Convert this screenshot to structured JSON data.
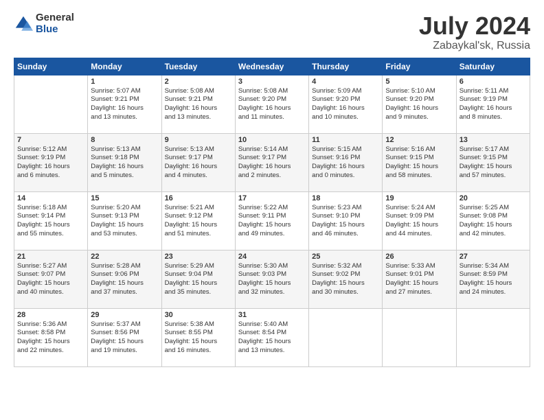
{
  "logo": {
    "general": "General",
    "blue": "Blue"
  },
  "title": "July 2024",
  "subtitle": "Zabaykal'sk, Russia",
  "days_header": [
    "Sunday",
    "Monday",
    "Tuesday",
    "Wednesday",
    "Thursday",
    "Friday",
    "Saturday"
  ],
  "weeks": [
    [
      {
        "num": "",
        "info": ""
      },
      {
        "num": "1",
        "info": "Sunrise: 5:07 AM\nSunset: 9:21 PM\nDaylight: 16 hours\nand 13 minutes."
      },
      {
        "num": "2",
        "info": "Sunrise: 5:08 AM\nSunset: 9:21 PM\nDaylight: 16 hours\nand 13 minutes."
      },
      {
        "num": "3",
        "info": "Sunrise: 5:08 AM\nSunset: 9:20 PM\nDaylight: 16 hours\nand 11 minutes."
      },
      {
        "num": "4",
        "info": "Sunrise: 5:09 AM\nSunset: 9:20 PM\nDaylight: 16 hours\nand 10 minutes."
      },
      {
        "num": "5",
        "info": "Sunrise: 5:10 AM\nSunset: 9:20 PM\nDaylight: 16 hours\nand 9 minutes."
      },
      {
        "num": "6",
        "info": "Sunrise: 5:11 AM\nSunset: 9:19 PM\nDaylight: 16 hours\nand 8 minutes."
      }
    ],
    [
      {
        "num": "7",
        "info": "Sunrise: 5:12 AM\nSunset: 9:19 PM\nDaylight: 16 hours\nand 6 minutes."
      },
      {
        "num": "8",
        "info": "Sunrise: 5:13 AM\nSunset: 9:18 PM\nDaylight: 16 hours\nand 5 minutes."
      },
      {
        "num": "9",
        "info": "Sunrise: 5:13 AM\nSunset: 9:17 PM\nDaylight: 16 hours\nand 4 minutes."
      },
      {
        "num": "10",
        "info": "Sunrise: 5:14 AM\nSunset: 9:17 PM\nDaylight: 16 hours\nand 2 minutes."
      },
      {
        "num": "11",
        "info": "Sunrise: 5:15 AM\nSunset: 9:16 PM\nDaylight: 16 hours\nand 0 minutes."
      },
      {
        "num": "12",
        "info": "Sunrise: 5:16 AM\nSunset: 9:15 PM\nDaylight: 15 hours\nand 58 minutes."
      },
      {
        "num": "13",
        "info": "Sunrise: 5:17 AM\nSunset: 9:15 PM\nDaylight: 15 hours\nand 57 minutes."
      }
    ],
    [
      {
        "num": "14",
        "info": "Sunrise: 5:18 AM\nSunset: 9:14 PM\nDaylight: 15 hours\nand 55 minutes."
      },
      {
        "num": "15",
        "info": "Sunrise: 5:20 AM\nSunset: 9:13 PM\nDaylight: 15 hours\nand 53 minutes."
      },
      {
        "num": "16",
        "info": "Sunrise: 5:21 AM\nSunset: 9:12 PM\nDaylight: 15 hours\nand 51 minutes."
      },
      {
        "num": "17",
        "info": "Sunrise: 5:22 AM\nSunset: 9:11 PM\nDaylight: 15 hours\nand 49 minutes."
      },
      {
        "num": "18",
        "info": "Sunrise: 5:23 AM\nSunset: 9:10 PM\nDaylight: 15 hours\nand 46 minutes."
      },
      {
        "num": "19",
        "info": "Sunrise: 5:24 AM\nSunset: 9:09 PM\nDaylight: 15 hours\nand 44 minutes."
      },
      {
        "num": "20",
        "info": "Sunrise: 5:25 AM\nSunset: 9:08 PM\nDaylight: 15 hours\nand 42 minutes."
      }
    ],
    [
      {
        "num": "21",
        "info": "Sunrise: 5:27 AM\nSunset: 9:07 PM\nDaylight: 15 hours\nand 40 minutes."
      },
      {
        "num": "22",
        "info": "Sunrise: 5:28 AM\nSunset: 9:06 PM\nDaylight: 15 hours\nand 37 minutes."
      },
      {
        "num": "23",
        "info": "Sunrise: 5:29 AM\nSunset: 9:04 PM\nDaylight: 15 hours\nand 35 minutes."
      },
      {
        "num": "24",
        "info": "Sunrise: 5:30 AM\nSunset: 9:03 PM\nDaylight: 15 hours\nand 32 minutes."
      },
      {
        "num": "25",
        "info": "Sunrise: 5:32 AM\nSunset: 9:02 PM\nDaylight: 15 hours\nand 30 minutes."
      },
      {
        "num": "26",
        "info": "Sunrise: 5:33 AM\nSunset: 9:01 PM\nDaylight: 15 hours\nand 27 minutes."
      },
      {
        "num": "27",
        "info": "Sunrise: 5:34 AM\nSunset: 8:59 PM\nDaylight: 15 hours\nand 24 minutes."
      }
    ],
    [
      {
        "num": "28",
        "info": "Sunrise: 5:36 AM\nSunset: 8:58 PM\nDaylight: 15 hours\nand 22 minutes."
      },
      {
        "num": "29",
        "info": "Sunrise: 5:37 AM\nSunset: 8:56 PM\nDaylight: 15 hours\nand 19 minutes."
      },
      {
        "num": "30",
        "info": "Sunrise: 5:38 AM\nSunset: 8:55 PM\nDaylight: 15 hours\nand 16 minutes."
      },
      {
        "num": "31",
        "info": "Sunrise: 5:40 AM\nSunset: 8:54 PM\nDaylight: 15 hours\nand 13 minutes."
      },
      {
        "num": "",
        "info": ""
      },
      {
        "num": "",
        "info": ""
      },
      {
        "num": "",
        "info": ""
      }
    ]
  ]
}
